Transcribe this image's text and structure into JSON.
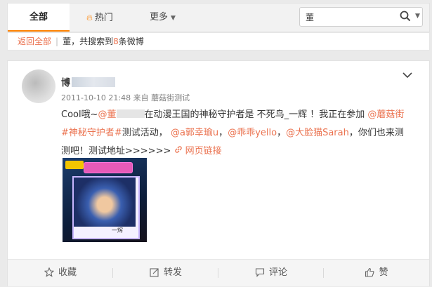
{
  "tabs": [
    {
      "label": "全部",
      "active": true
    },
    {
      "label": "热门",
      "icon": "fire-icon"
    },
    {
      "label": "更多",
      "icon": "chevron-down-icon"
    }
  ],
  "search": {
    "value": "董"
  },
  "breadcrumb": {
    "back_label": "返回全部",
    "query": "董",
    "result_prefix": "，共搜索到",
    "count": "8",
    "result_suffix": "条微博"
  },
  "post": {
    "author": "博",
    "timestamp": "2011-10-10 21:48",
    "source_prefix": "来自",
    "source": "蘑菇街测试",
    "text": {
      "p1": "Cool哦~",
      "m1": "@董",
      "p2": "在动漫王国的神秘守护者是 不死鸟_一辉 ！我正在参加",
      "m2": "@蘑菇街",
      "t1": "#神秘守护者#",
      "p3": "测试活动，",
      "m3": "@a郭幸瑜u",
      "p4": "，",
      "m4": "@乖乖yello",
      "p5": "，",
      "m5": "@大脸猫Sarah",
      "p6": "，你们也来测测吧！测试地址>>>>>>",
      "link": "网页链接"
    },
    "image_caption": "一辉"
  },
  "actions": [
    {
      "label": "收藏",
      "icon": "star-icon"
    },
    {
      "label": "转发",
      "icon": "forward-icon"
    },
    {
      "label": "评论",
      "icon": "comment-icon"
    },
    {
      "label": "赞",
      "icon": "thumbs-up-icon"
    }
  ],
  "colors": {
    "accent": "#ff8200",
    "link": "#eb7350"
  }
}
